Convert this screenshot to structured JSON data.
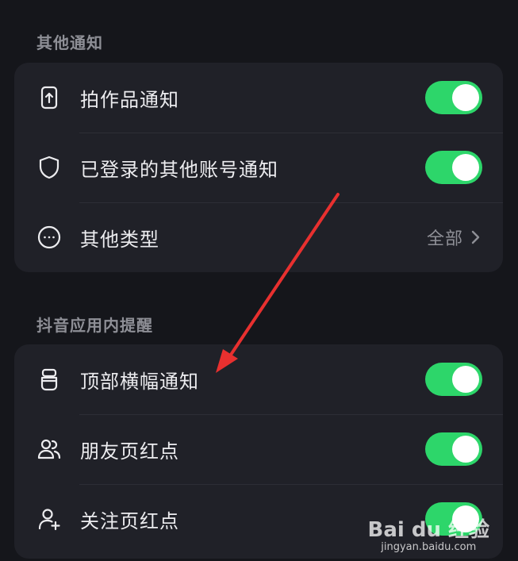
{
  "sections": [
    {
      "title": "其他通知",
      "items": [
        {
          "icon": "upload-phone-icon",
          "label": "拍作品通知",
          "control": "toggle",
          "on": true
        },
        {
          "icon": "shield-icon",
          "label": "已登录的其他账号通知",
          "control": "toggle",
          "on": true
        },
        {
          "icon": "more-circle-icon",
          "label": "其他类型",
          "control": "value",
          "value": "全部"
        }
      ]
    },
    {
      "title": "抖音应用内提醒",
      "items": [
        {
          "icon": "banner-icon",
          "label": "顶部横幅通知",
          "control": "toggle",
          "on": true
        },
        {
          "icon": "friends-icon",
          "label": "朋友页红点",
          "control": "toggle",
          "on": true
        },
        {
          "icon": "add-user-icon",
          "label": "关注页红点",
          "control": "toggle",
          "on": true
        }
      ]
    }
  ],
  "colors": {
    "background": "#15161b",
    "card": "#202128",
    "toggle_on": "#2dd66a",
    "annotation_arrow": "#e8302f"
  },
  "watermark": {
    "logo_text": "Bai du 经验",
    "url": "jingyan.baidu.com"
  }
}
